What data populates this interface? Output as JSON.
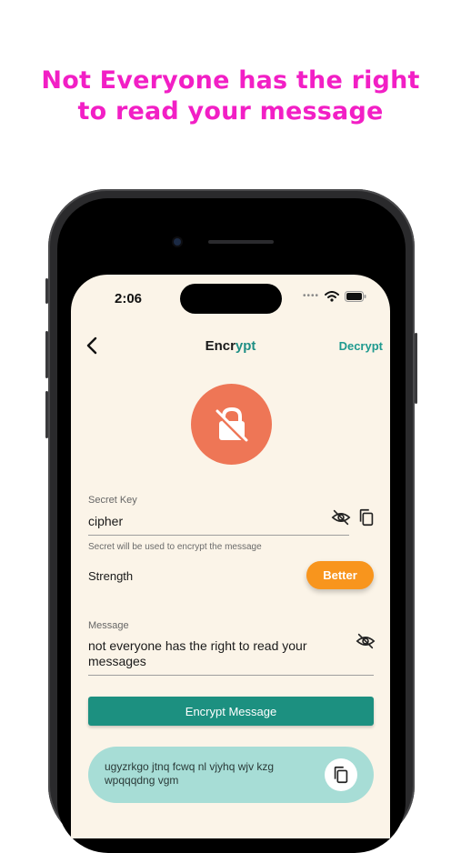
{
  "headline": {
    "line1": "Not Everyone has the right",
    "line2": "to read your message",
    "color": "#f21fc5"
  },
  "status_bar": {
    "time": "2:06",
    "icons": [
      "cellular-signal-icon",
      "wifi-icon",
      "battery-icon"
    ]
  },
  "nav": {
    "back_icon": "chevron-left-icon",
    "title_prefix": "Encr",
    "title_accent": "ypt",
    "decrypt_label": "Decrypt"
  },
  "hero": {
    "icon": "lock-off-icon",
    "color": "#ee7656"
  },
  "secret_key": {
    "label": "Secret Key",
    "value": "cipher",
    "helper": "Secret will be used to encrypt the message",
    "visibility_icon": "eye-off-icon",
    "copy_icon": "copy-icon"
  },
  "strength": {
    "label": "Strength",
    "badge": "Better",
    "badge_color": "#f8951d"
  },
  "message": {
    "label": "Message",
    "value": "not everyone has the right to read your messages",
    "visibility_icon": "eye-off-icon"
  },
  "encrypt_button": {
    "label": "Encrypt Message",
    "color": "#1c9080"
  },
  "result": {
    "text": "ugyzrkgo jtnq fcwq nl vjyhq wjv kzg wpqqqdng vgm",
    "copy_icon": "copy-icon",
    "background": "#a7ddd6"
  }
}
